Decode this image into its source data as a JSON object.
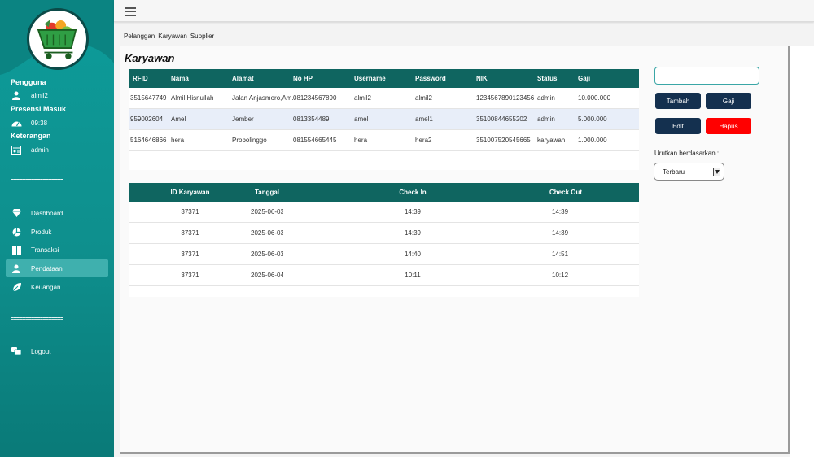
{
  "sidebar": {
    "user_heading": "Pengguna",
    "user_name": "almil2",
    "presence_heading": "Presensi Masuk",
    "presence_time": "09:38",
    "info_heading": "Keterangan",
    "info_role": "admin",
    "separator": "==================",
    "nav": [
      {
        "label": "Dashboard",
        "icon": "diamond-icon"
      },
      {
        "label": "Produk",
        "icon": "products-icon"
      },
      {
        "label": "Transaksi",
        "icon": "grid-icon"
      },
      {
        "label": "Pendataan",
        "icon": "user-icon",
        "active": true
      },
      {
        "label": "Keuangan",
        "icon": "leaf-icon"
      }
    ],
    "logout_label": "Logout"
  },
  "tabs": [
    "Pelanggan",
    "Karyawan",
    "Supplier"
  ],
  "active_tab": "Karyawan",
  "page_title": "Karyawan",
  "employees": {
    "headers": [
      "RFID",
      "Nama",
      "Alamat",
      "No HP",
      "Username",
      "Password",
      "NIK",
      "Status",
      "Gaji"
    ],
    "rows": [
      [
        "3515647749",
        "Almil Hisnullah",
        "Jalan Anjasmoro,Am...",
        "081234567890",
        "almil2",
        "almil2",
        "1234567890123456",
        "admin",
        "10.000.000"
      ],
      [
        "959002604",
        "Amel",
        "Jember",
        "0813354489",
        "amel",
        "amel1",
        "35100844655202",
        "admin",
        "5.000.000"
      ],
      [
        "5164646866",
        "hera",
        "Probolinggo",
        "081554665445",
        "hera",
        "hera2",
        "351007520545665",
        "karyawan",
        "1.000.000"
      ]
    ]
  },
  "attendance": {
    "headers": [
      "ID Karyawan",
      "Tanggal",
      "Check In",
      "Check Out"
    ],
    "rows": [
      [
        "37371",
        "2025-06-03",
        "14:39",
        "14:39"
      ],
      [
        "37371",
        "2025-06-03",
        "14:39",
        "14:39"
      ],
      [
        "37371",
        "2025-06-03",
        "14:40",
        "14:51"
      ],
      [
        "37371",
        "2025-06-04",
        "10:11",
        "10:12"
      ]
    ]
  },
  "controls": {
    "search_value": "",
    "add_label": "Tambah",
    "salary_label": "Gaji",
    "edit_label": "Edit",
    "delete_label": "Hapus",
    "sort_label": "Urutkan berdasarkan :",
    "sort_value": "Terbaru"
  },
  "colors": {
    "sidebar": "#0d9c9a",
    "table_header": "#0f6560",
    "navy_button": "#14304f",
    "delete_button": "#ff0000"
  }
}
